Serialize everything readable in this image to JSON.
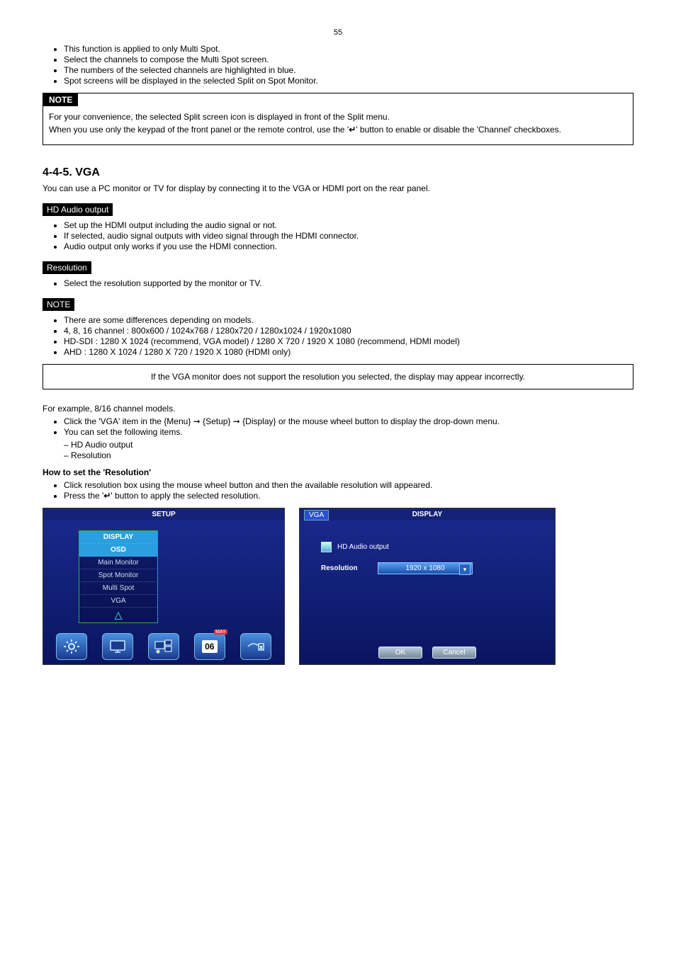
{
  "page_number": "55",
  "intro_list": [
    "This function is applied to only Multi Spot.",
    "Select the channels to compose the Multi Spot screen.",
    "The numbers of the selected channels are highlighted in blue.",
    "Spot screens will be displayed in the selected Split on Spot Monitor."
  ],
  "note1": {
    "label": "NOTE",
    "line1": "For your convenience, the selected Split screen icon is displayed in front of the Split menu.",
    "line2_a": "When you use only the keypad of the front panel or the remote control, use the '",
    "line2_b": "' button to enable or disable the 'Channel' checkboxes."
  },
  "section_vga": "4-4-5. VGA",
  "vga_intro": "You can use a PC monitor or TV for display by connecting it to the VGA or HDMI port on the rear panel.",
  "hdg_audio": {
    "title": "HD Audio output",
    "items": [
      "Set up the HDMI output including the audio signal or not.",
      "If selected, audio signal outputs with video signal through the HDMI connector.",
      "Audio output only works if you use the HDMI connection."
    ]
  },
  "hdg_res": {
    "title": "Resolution",
    "items": [
      "Select the resolution supported by the monitor or TV."
    ]
  },
  "note2_title": "NOTE",
  "note2_items": [
    "There are some differences depending on models.",
    "4, 8, 16 channel : 800x600 / 1024x768 / 1280x720 / 1280x1024 / 1920x1080",
    "HD-SDI : 1280 X 1024 (recommend, VGA model) / 1280 X 720 / 1920 X 1080 (recommend, HDMI model)",
    "AHD : 1280 X 1024 / 1280 X 720 / 1920 X 1080 (HDMI only)"
  ],
  "note3_box": "If the VGA monitor does not support the resolution you selected, the display may appear incorrectly.",
  "vga_ex": {
    "lead": "For example, 8/16 channel models.",
    "b1": "Click the 'VGA' item in the {Menu} ➞ {Setup} ➞ {Display} or the mouse wheel button to display the drop-down menu.",
    "b2": "You can set the following items.",
    "sub1": "HD Audio output",
    "sub2": "Resolution"
  },
  "howto": {
    "title": "How to set the 'Resolution'",
    "b1": "Click resolution box using the mouse wheel button and then the available resolution will appeared.",
    "b2_a": "Press the '",
    "b2_b": "' button to apply the selected resolution."
  },
  "scr_left": {
    "title": "SETUP",
    "menu": [
      "DISPLAY",
      "OSD",
      "Main Monitor",
      "Spot Monitor",
      "Multi Spot",
      "VGA"
    ],
    "icons": [
      "gear-icon",
      "monitor-icon",
      "spot-icon",
      "calendar-icon",
      "net-icon"
    ],
    "cal_month": "MAY",
    "cal_day": "06"
  },
  "scr_right": {
    "title": "DISPLAY",
    "tab": "VGA",
    "chk_label": "HD Audio output",
    "res_label": "Resolution",
    "res_value": "1920 x 1080",
    "ok": "OK",
    "cancel": "Cancel"
  }
}
